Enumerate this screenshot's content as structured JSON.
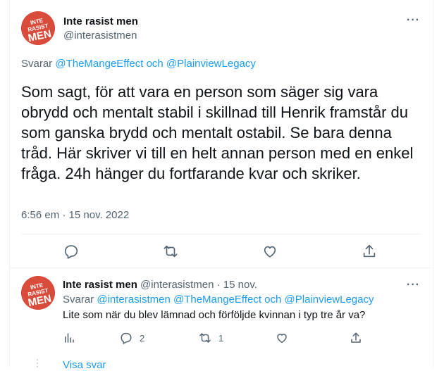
{
  "main_tweet": {
    "avatar_text": "INTE RASIST MEN",
    "display_name": "Inte rasist men",
    "handle": "@interasistmen",
    "more_label": "···",
    "replying_prefix": "Svarar",
    "replying_user1": "@TheMangeEffect",
    "replying_and": "och",
    "replying_user2": "@PlainviewLegacy",
    "text": "Som sagt, för att vara en person som säger sig vara obrydd och mentalt stabil i skillnad till Henrik framstår du som ganska brydd och mentalt ostabil. Se bara denna tråd. Här skriver vi till en helt annan person med en enkel fråga. 24h hänger du fortfarande kvar och skriker.",
    "timestamp": "6:56 em · 15 nov. 2022"
  },
  "reply_tweet": {
    "avatar_text": "INTE RASIST MEN",
    "display_name": "Inte rasist men",
    "handle_date": "@interasistmen · 15 nov.",
    "more_label": "···",
    "replying_prefix": "Svarar",
    "replying_user1": "@interasistmen",
    "replying_user2": "@TheMangeEffect",
    "replying_and": "och",
    "replying_user3": "@PlainviewLegacy",
    "text": "Lite som när du blev lämnad och förföljde kvinnan i typ tre år va?",
    "reply_count": "2",
    "retweet_count": "1",
    "show_replies": "Visa svar"
  },
  "colors": {
    "accent": "#1d9bf0",
    "secondary_text": "#536471",
    "avatar_bg": "#d94b3a",
    "border": "#eff3f4"
  },
  "icons": [
    "reply-icon",
    "retweet-icon",
    "like-icon",
    "share-icon",
    "analytics-icon",
    "more-icon"
  ]
}
